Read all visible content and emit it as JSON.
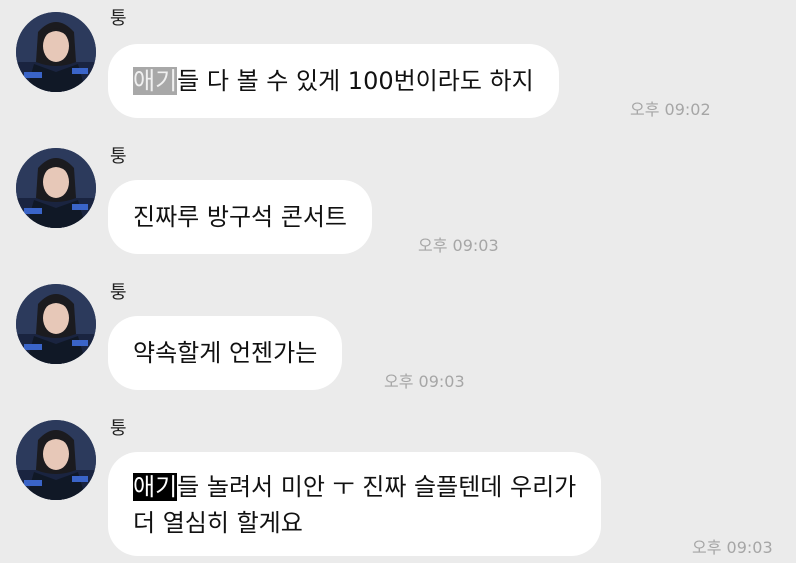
{
  "messages": [
    {
      "sender": "퉁",
      "lines": [
        {
          "highlight": "애기",
          "rest": "들 다 볼 수 있게 100번이라도 하지"
        }
      ],
      "time": "오후 09:02"
    },
    {
      "sender": "퉁",
      "lines": [
        {
          "highlight": "",
          "rest": "진짜루 방구석 콘서트"
        }
      ],
      "time": "오후 09:03"
    },
    {
      "sender": "퉁",
      "lines": [
        {
          "highlight": "",
          "rest": "약속할게 언젠가는"
        }
      ],
      "time": "오후 09:03"
    },
    {
      "sender": "퉁",
      "lines": [
        {
          "highlight": "애기",
          "rest": "들 놀려서 미안 ㅜ 진짜 슬플텐데 우리가"
        },
        {
          "highlight": "",
          "rest": "더 열심히 할게요"
        }
      ],
      "time": "오후 09:03"
    }
  ],
  "colors": {
    "background": "#ebebeb",
    "bubble": "#ffffff",
    "timestamp": "#a6a6a6",
    "highlight_gray": "#a8a8a8",
    "highlight_black": "#000000"
  },
  "icons": {
    "avatar": "profile-photo"
  }
}
